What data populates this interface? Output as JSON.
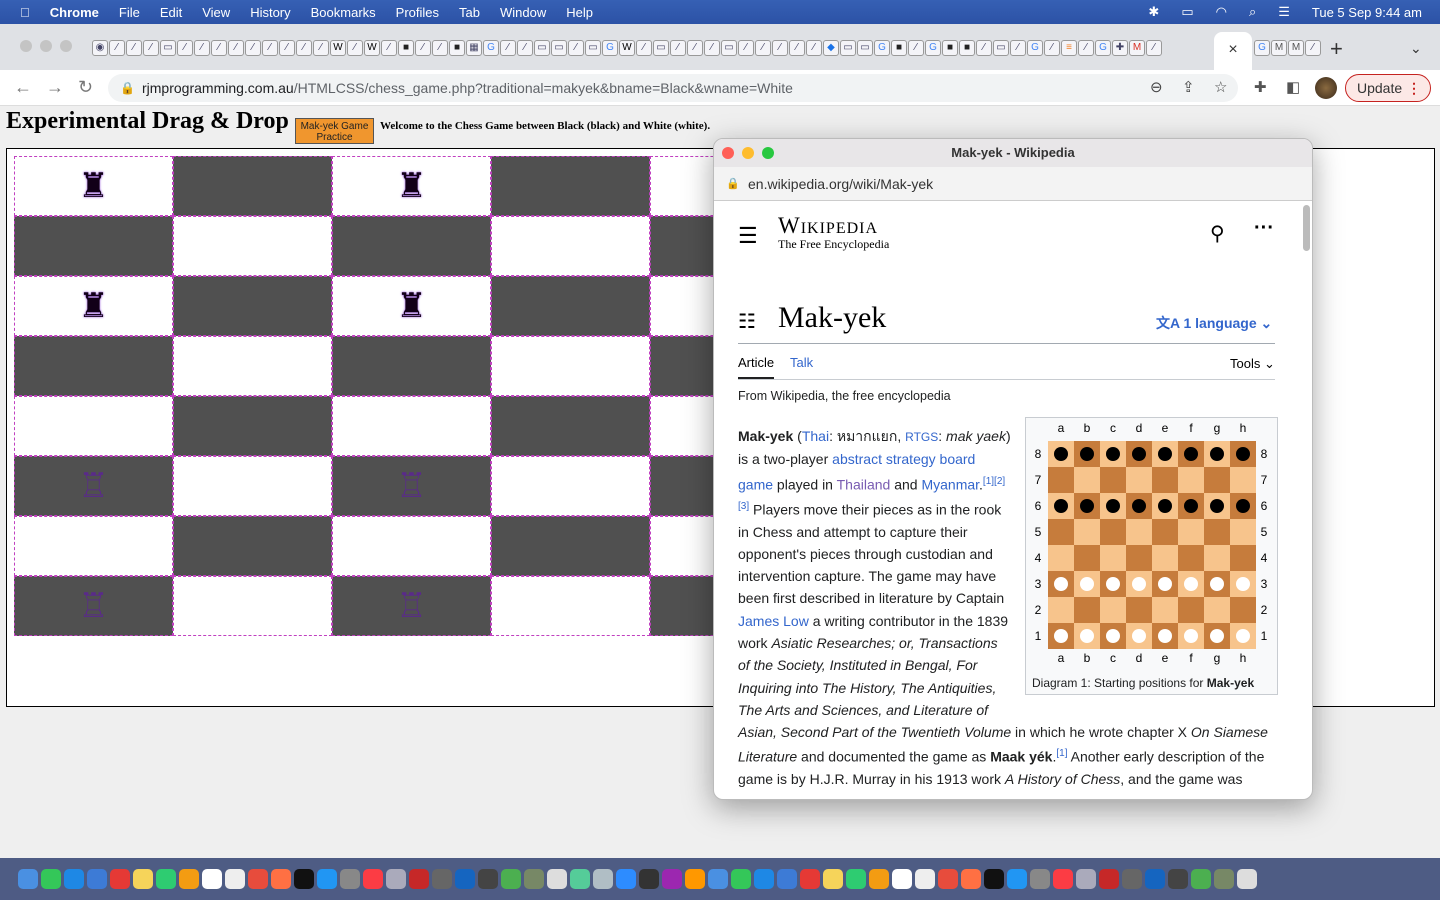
{
  "menubar": {
    "app": "Chrome",
    "items": [
      "File",
      "Edit",
      "View",
      "History",
      "Bookmarks",
      "Profiles",
      "Tab",
      "Window",
      "Help"
    ],
    "clock": "Tue 5 Sep  9:44 am"
  },
  "tabs": {
    "favicons": [
      "chrome",
      "feather",
      "feather",
      "feather",
      "page",
      "feather",
      "feather",
      "feather",
      "feather",
      "feather",
      "feather",
      "feather",
      "feather",
      "feather",
      "wikipedia",
      "feather",
      "wikipedia",
      "feather",
      "dark",
      "feather",
      "feather",
      "dark",
      "grid",
      "google",
      "feather",
      "feather",
      "page",
      "page",
      "feather",
      "page",
      "google",
      "wikipedia",
      "feather",
      "page",
      "feather",
      "feather",
      "feather",
      "page",
      "feather",
      "feather",
      "feather",
      "feather",
      "feather",
      "blue",
      "page",
      "page",
      "google",
      "dark",
      "feather",
      "google",
      "dark",
      "dark",
      "feather",
      "page",
      "feather",
      "google",
      "feather",
      "stack",
      "feather",
      "google",
      "puzzle",
      "gmail",
      "feather"
    ],
    "after_active": [
      "google",
      "medium",
      "medium",
      "feather"
    ],
    "active_close": "×",
    "new_tab": "+"
  },
  "toolbar": {
    "url_host": "rjmprogramming.com.au",
    "url_path": "/HTMLCSS/chess_game.php?traditional=makyek&bname=Black&wname=White",
    "update_label": "Update"
  },
  "page": {
    "title": "Experimental Drag & Drop",
    "practice_button": "Mak-yek Game Practice",
    "welcome": "Welcome to the Chess Game between Black (black) and White (white).",
    "board": {
      "rows": [
        [
          "b",
          "",
          "b",
          "",
          "b",
          "",
          "b",
          ""
        ],
        [
          "",
          "",
          "",
          "",
          "",
          "",
          "",
          ""
        ],
        [
          "b",
          "",
          "b",
          "",
          "b",
          "",
          "b",
          ""
        ],
        [
          "",
          "",
          "",
          "",
          "",
          "",
          "",
          ""
        ],
        [
          "",
          "",
          "",
          "",
          "",
          "",
          "",
          ""
        ],
        [
          "w",
          "",
          "w",
          "",
          "w",
          "",
          "w",
          ""
        ],
        [
          "",
          "",
          "",
          "",
          "",
          "",
          "",
          ""
        ],
        [
          "w",
          "",
          "w",
          "",
          "w",
          "",
          "w",
          ""
        ]
      ],
      "visible_pieces": [
        [
          "b",
          "b",
          "b",
          "b"
        ],
        [],
        [
          "b",
          "b",
          "b",
          "b"
        ],
        [],
        [],
        [
          "w",
          "w",
          "w",
          "w"
        ],
        [],
        [
          "w",
          "w",
          "w",
          "w"
        ]
      ],
      "black_piece": "♜",
      "white_piece": "♖"
    }
  },
  "wiki_window": {
    "title": "Mak-yek - Wikipedia",
    "url": "en.wikipedia.org/wiki/Mak-yek",
    "logo_title": "Wikipedia",
    "logo_tagline": "The Free Encyclopedia",
    "article_title": "Mak-yek",
    "language_button": "1 language",
    "tab_article": "Article",
    "tab_talk": "Talk",
    "tools": "Tools",
    "from": "From Wikipedia, the free encyclopedia",
    "body": {
      "b1": "Mak-yek",
      "t1": " (",
      "l_thai": "Thai",
      "t2": ": หมากแยก, ",
      "l_rtgs": "RTGS",
      "t3": ": ",
      "i1": "mak yaek",
      "t4": ") is a two-player ",
      "l_abs": "abstract strategy board game",
      "t5": " played in ",
      "l_thailand": "Thailand",
      "t6": " and ",
      "l_myanmar": "Myanmar",
      "t7": ".",
      "refs": "[1][2][3]",
      "t8": " Players move their pieces as in the rook in Chess and attempt to capture their opponent's pieces through custodian and intervention capture. The game may have been first described in literature by Captain ",
      "l_low": "James Low",
      "t9": " a writing contributor in the 1839 work ",
      "i2": "Asiatic Researches; or, Transactions of the Society, Instituted in Bengal, For Inquiring into The History, The Antiquities, The Arts and Sciences, and Literature of Asian, Second Part of the Twentieth Volume",
      "t10": " in which he wrote chapter X ",
      "i3": "On Siamese Literature",
      "t11": " and documented the game as ",
      "b2": "Maak yék",
      "t12": ".",
      "ref1": "[1]",
      "t13": " Another early description of the game is by H.J.R. Murray in his 1913 work ",
      "i4": "A History of Chess",
      "t14": ", and the game was"
    },
    "diagram": {
      "files": [
        "a",
        "b",
        "c",
        "d",
        "e",
        "f",
        "g",
        "h"
      ],
      "ranks": [
        "8",
        "7",
        "6",
        "5",
        "4",
        "3",
        "2",
        "1"
      ],
      "black_ranks": [
        "8",
        "6"
      ],
      "white_ranks": [
        "3",
        "1"
      ],
      "light_color": "#f7c48c",
      "dark_color": "#c67c3c",
      "caption_prefix": "Diagram 1: Starting positions for ",
      "caption_bold": "Mak-yek"
    }
  },
  "dock": {
    "icons": [
      "finder",
      "messages",
      "safari",
      "mail",
      "opera",
      "notes",
      "facetime",
      "photos",
      "calendar",
      "reminders",
      "news",
      "firefox",
      "tv",
      "appstore",
      "settings",
      "music",
      "launchpad",
      "filezilla",
      "calculator",
      "xcode",
      "bbedit",
      "chrome",
      "gimp",
      "textedit",
      "maps",
      "preview",
      "zoom",
      "quicktime",
      "podcasts",
      "books",
      "photobooth",
      "chrome",
      "safari",
      "camera",
      "terminal",
      "acrobat",
      "terminal",
      "chrome",
      "terminal",
      "folder",
      "network",
      "folder",
      "folder",
      "folder",
      "folder",
      "folder",
      "folder",
      "folder",
      "folder",
      "folder",
      "folder",
      "folder",
      "folder",
      "trash"
    ]
  },
  "colors": {
    "accent_link": "#3366cc",
    "practice_button": "#f0962e",
    "cell_dark": "#505050",
    "cell_border": "#c040c0"
  }
}
